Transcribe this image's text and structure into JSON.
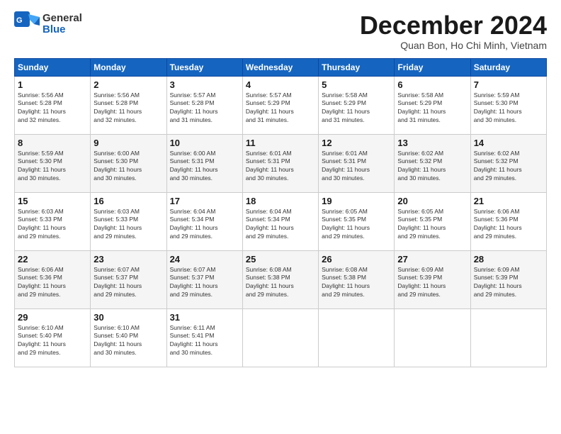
{
  "logo": {
    "general": "General",
    "blue": "Blue"
  },
  "header": {
    "month_title": "December 2024",
    "location": "Quan Bon, Ho Chi Minh, Vietnam"
  },
  "weekdays": [
    "Sunday",
    "Monday",
    "Tuesday",
    "Wednesday",
    "Thursday",
    "Friday",
    "Saturday"
  ],
  "weeks": [
    [
      {
        "day": "1",
        "sunrise": "5:56 AM",
        "sunset": "5:28 PM",
        "daylight": "11 hours and 32 minutes."
      },
      {
        "day": "2",
        "sunrise": "5:56 AM",
        "sunset": "5:28 PM",
        "daylight": "11 hours and 32 minutes."
      },
      {
        "day": "3",
        "sunrise": "5:57 AM",
        "sunset": "5:28 PM",
        "daylight": "11 hours and 31 minutes."
      },
      {
        "day": "4",
        "sunrise": "5:57 AM",
        "sunset": "5:29 PM",
        "daylight": "11 hours and 31 minutes."
      },
      {
        "day": "5",
        "sunrise": "5:58 AM",
        "sunset": "5:29 PM",
        "daylight": "11 hours and 31 minutes."
      },
      {
        "day": "6",
        "sunrise": "5:58 AM",
        "sunset": "5:29 PM",
        "daylight": "11 hours and 31 minutes."
      },
      {
        "day": "7",
        "sunrise": "5:59 AM",
        "sunset": "5:30 PM",
        "daylight": "11 hours and 30 minutes."
      }
    ],
    [
      {
        "day": "8",
        "sunrise": "5:59 AM",
        "sunset": "5:30 PM",
        "daylight": "11 hours and 30 minutes."
      },
      {
        "day": "9",
        "sunrise": "6:00 AM",
        "sunset": "5:30 PM",
        "daylight": "11 hours and 30 minutes."
      },
      {
        "day": "10",
        "sunrise": "6:00 AM",
        "sunset": "5:31 PM",
        "daylight": "11 hours and 30 minutes."
      },
      {
        "day": "11",
        "sunrise": "6:01 AM",
        "sunset": "5:31 PM",
        "daylight": "11 hours and 30 minutes."
      },
      {
        "day": "12",
        "sunrise": "6:01 AM",
        "sunset": "5:31 PM",
        "daylight": "11 hours and 30 minutes."
      },
      {
        "day": "13",
        "sunrise": "6:02 AM",
        "sunset": "5:32 PM",
        "daylight": "11 hours and 30 minutes."
      },
      {
        "day": "14",
        "sunrise": "6:02 AM",
        "sunset": "5:32 PM",
        "daylight": "11 hours and 29 minutes."
      }
    ],
    [
      {
        "day": "15",
        "sunrise": "6:03 AM",
        "sunset": "5:33 PM",
        "daylight": "11 hours and 29 minutes."
      },
      {
        "day": "16",
        "sunrise": "6:03 AM",
        "sunset": "5:33 PM",
        "daylight": "11 hours and 29 minutes."
      },
      {
        "day": "17",
        "sunrise": "6:04 AM",
        "sunset": "5:34 PM",
        "daylight": "11 hours and 29 minutes."
      },
      {
        "day": "18",
        "sunrise": "6:04 AM",
        "sunset": "5:34 PM",
        "daylight": "11 hours and 29 minutes."
      },
      {
        "day": "19",
        "sunrise": "6:05 AM",
        "sunset": "5:35 PM",
        "daylight": "11 hours and 29 minutes."
      },
      {
        "day": "20",
        "sunrise": "6:05 AM",
        "sunset": "5:35 PM",
        "daylight": "11 hours and 29 minutes."
      },
      {
        "day": "21",
        "sunrise": "6:06 AM",
        "sunset": "5:36 PM",
        "daylight": "11 hours and 29 minutes."
      }
    ],
    [
      {
        "day": "22",
        "sunrise": "6:06 AM",
        "sunset": "5:36 PM",
        "daylight": "11 hours and 29 minutes."
      },
      {
        "day": "23",
        "sunrise": "6:07 AM",
        "sunset": "5:37 PM",
        "daylight": "11 hours and 29 minutes."
      },
      {
        "day": "24",
        "sunrise": "6:07 AM",
        "sunset": "5:37 PM",
        "daylight": "11 hours and 29 minutes."
      },
      {
        "day": "25",
        "sunrise": "6:08 AM",
        "sunset": "5:38 PM",
        "daylight": "11 hours and 29 minutes."
      },
      {
        "day": "26",
        "sunrise": "6:08 AM",
        "sunset": "5:38 PM",
        "daylight": "11 hours and 29 minutes."
      },
      {
        "day": "27",
        "sunrise": "6:09 AM",
        "sunset": "5:39 PM",
        "daylight": "11 hours and 29 minutes."
      },
      {
        "day": "28",
        "sunrise": "6:09 AM",
        "sunset": "5:39 PM",
        "daylight": "11 hours and 29 minutes."
      }
    ],
    [
      {
        "day": "29",
        "sunrise": "6:10 AM",
        "sunset": "5:40 PM",
        "daylight": "11 hours and 29 minutes."
      },
      {
        "day": "30",
        "sunrise": "6:10 AM",
        "sunset": "5:40 PM",
        "daylight": "11 hours and 30 minutes."
      },
      {
        "day": "31",
        "sunrise": "6:11 AM",
        "sunset": "5:41 PM",
        "daylight": "11 hours and 30 minutes."
      },
      null,
      null,
      null,
      null
    ]
  ]
}
